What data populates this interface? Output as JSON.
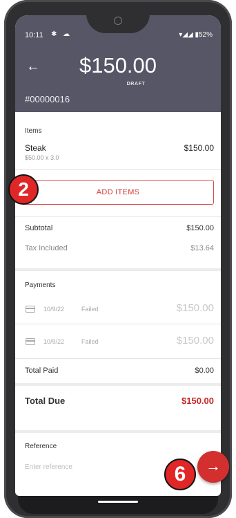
{
  "status_bar": {
    "time": "10:11",
    "left_icons": "✱ ☁",
    "battery": "▾◢◢ ▮52%"
  },
  "header": {
    "back_icon": "←",
    "amount": "$150.00",
    "state": "DRAFT",
    "order_id": "#00000016"
  },
  "items": {
    "section_label": "Items",
    "list": [
      {
        "name": "Steak",
        "detail": "$50.00  x 3.0",
        "price": "$150.00"
      }
    ],
    "add_button_label": "ADD ITEMS"
  },
  "summary": {
    "subtotal_label": "Subtotal",
    "subtotal_value": "$150.00",
    "tax_label": "Tax Included",
    "tax_value": "$13.64"
  },
  "payments": {
    "section_label": "Payments",
    "list": [
      {
        "date": "10/9/22",
        "status": "Failed",
        "amount": "$150.00"
      },
      {
        "date": "10/9/22",
        "status": "Failed",
        "amount": "$150.00"
      }
    ],
    "total_paid_label": "Total Paid",
    "total_paid_value": "$0.00"
  },
  "total_due": {
    "label": "Total Due",
    "value": "$150.00",
    "color": "#c62828"
  },
  "reference": {
    "label": "Reference",
    "placeholder": "Enter reference"
  },
  "fab_icon": "→",
  "step_badges": {
    "add_items_step": "2",
    "next_step": "6"
  },
  "colors": {
    "header_bg": "#565666",
    "accent": "#d32f2f"
  }
}
